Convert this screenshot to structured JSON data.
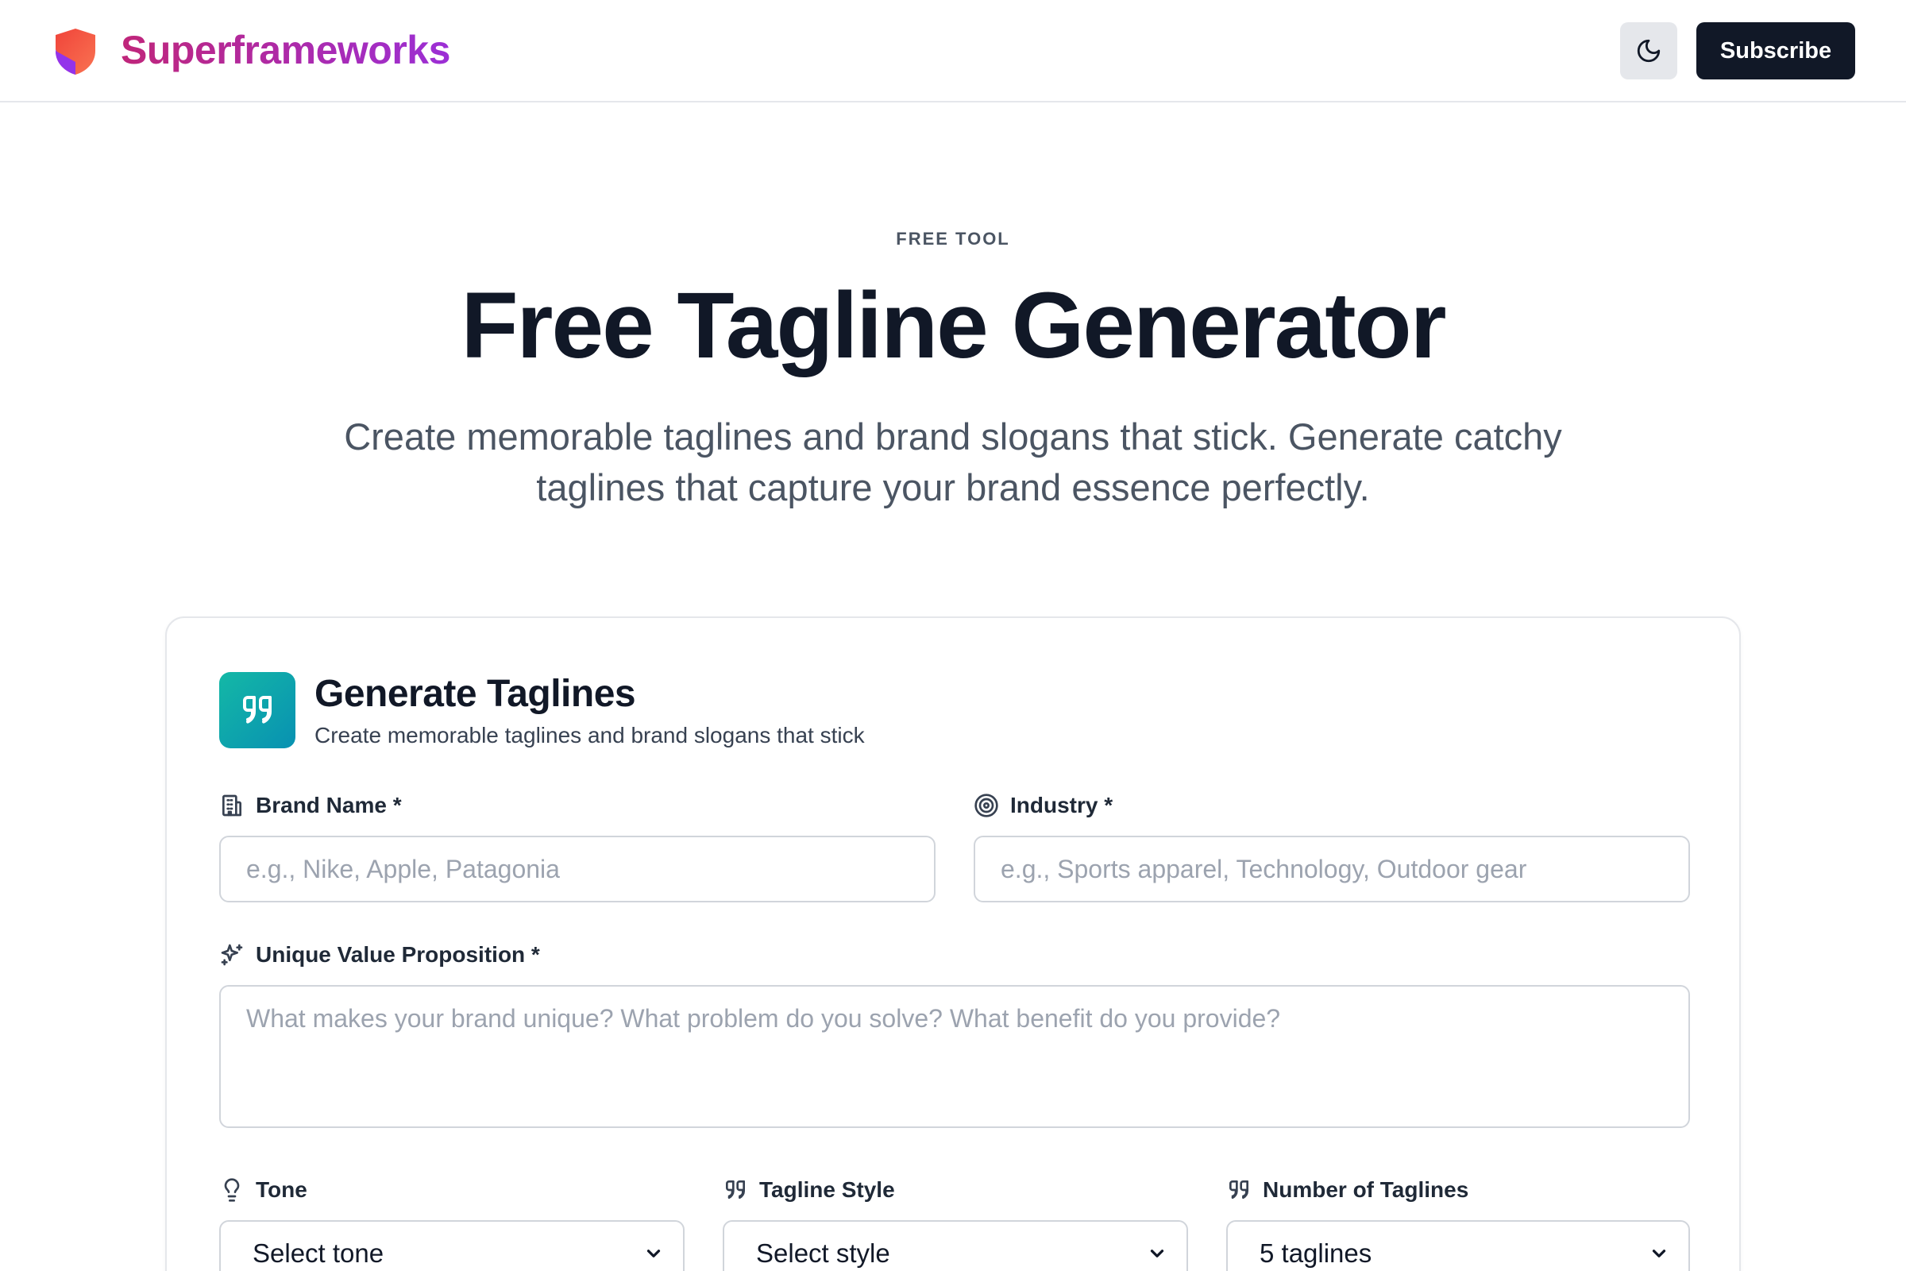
{
  "header": {
    "brand": "Superframeworks",
    "subscribe_label": "Subscribe",
    "logo_icon": "shield-icon",
    "theme_icon": "moon-icon"
  },
  "hero": {
    "eyebrow": "FREE TOOL",
    "title": "Free Tagline Generator",
    "subtitle": "Create memorable taglines and brand slogans that stick. Generate catchy taglines that capture your brand essence perfectly."
  },
  "card": {
    "icon": "quote-icon",
    "title": "Generate Taglines",
    "subtitle": "Create memorable taglines and brand slogans that stick"
  },
  "form": {
    "brand_name": {
      "label": "Brand Name *",
      "placeholder": "e.g., Nike, Apple, Patagonia",
      "value": "",
      "icon": "building-icon"
    },
    "industry": {
      "label": "Industry *",
      "placeholder": "e.g., Sports apparel, Technology, Outdoor gear",
      "value": "",
      "icon": "target-icon"
    },
    "uvp": {
      "label": "Unique Value Proposition *",
      "placeholder": "What makes your brand unique? What problem do you solve? What benefit do you provide?",
      "value": "",
      "icon": "sparkles-icon"
    },
    "tone": {
      "label": "Tone",
      "selected": "Select tone",
      "icon": "lightbulb-icon"
    },
    "style": {
      "label": "Tagline Style",
      "selected": "Select style",
      "icon": "quote-icon"
    },
    "count": {
      "label": "Number of Taglines",
      "selected": "5 taglines",
      "icon": "quote-icon"
    }
  },
  "colors": {
    "brand_gradient_start": "#c0267a",
    "brand_gradient_end": "#9b2fd6",
    "primary_button": "#111827",
    "card_icon_start": "#14b8a6",
    "card_icon_end": "#0891b2"
  }
}
